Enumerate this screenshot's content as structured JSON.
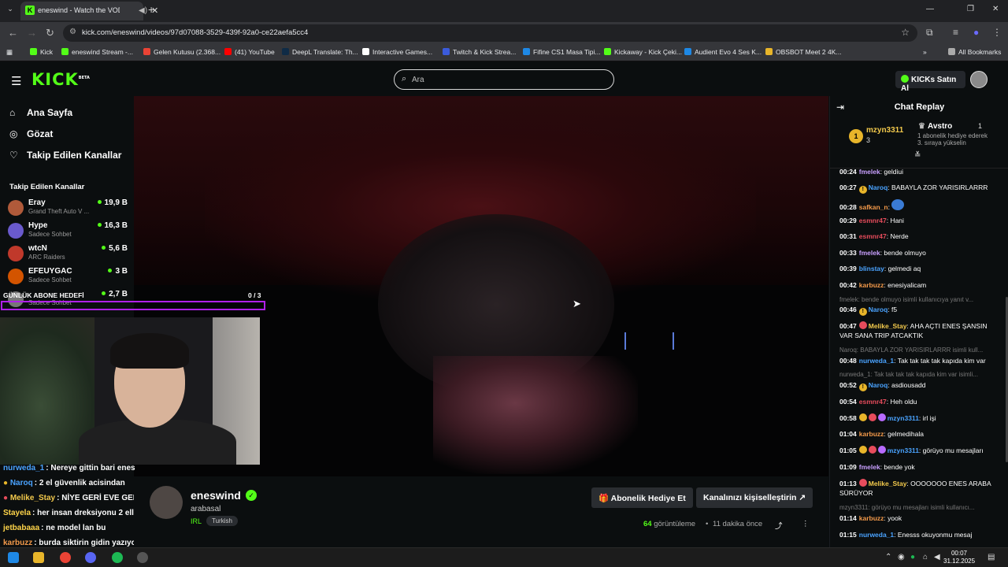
{
  "browser": {
    "tab_title": "eneswind - Watch the VOD",
    "url": "kick.com/eneswind/videos/97d07088-3529-439f-92a0-ce22aefa5cc4",
    "bookmarks": [
      "Kick",
      "eneswind Stream -...",
      "Gelen Kutusu (2.368...",
      "(41) YouTube",
      "DeepL Translate: Th...",
      "Interactive Games...",
      "Twitch & Kick Strea...",
      "Fifine CS1 Masa Tipi...",
      "Kickaway - Kick Çeki...",
      "Audient Evo 4 Ses K...",
      "OBSBOT Meet 2 4K..."
    ],
    "all_bookmarks": "All Bookmarks"
  },
  "header": {
    "logo": "KICK",
    "logo_badge": "BETA",
    "search_placeholder": "Ara",
    "kicks_button": "KICKs Satın Al"
  },
  "sidebar": {
    "nav": [
      {
        "label": "Ana Sayfa",
        "icon": "home-icon"
      },
      {
        "label": "Gözat",
        "icon": "browse-icon"
      },
      {
        "label": "Takip Edilen Kanallar",
        "icon": "heart-icon"
      }
    ],
    "following_title": "Takip Edilen Kanallar",
    "channels": [
      {
        "name": "Eray",
        "category": "Grand Theft Auto V ...",
        "viewers": "19,9 B",
        "color": "#b05a3a"
      },
      {
        "name": "Hype",
        "category": "Sadece Sohbet",
        "viewers": "16,3 B",
        "color": "#6a5acd"
      },
      {
        "name": "wtcN",
        "category": "ARC Raiders",
        "viewers": "5,6 B",
        "color": "#c0392b"
      },
      {
        "name": "EFEUYGAC",
        "category": "Sadece Sohbet",
        "viewers": "3 B",
        "color": "#d35400"
      },
      {
        "name": "",
        "category": "Sadece Sohbet",
        "viewers": "2,7 B",
        "color": "#777"
      }
    ]
  },
  "overlay": {
    "goal_label": "GÜNLÜK ABONE HEDEFİ",
    "goal_count": "0 / 3",
    "chat": [
      {
        "user": "nurweda_1",
        "text": ": Nereye gittin bari enes",
        "color": "#4aa3ff"
      },
      {
        "user": "Naroq",
        "text": ": 2 el güvenlik acisindan",
        "color": "#4aa3ff"
      },
      {
        "user": "Melike_Stay",
        "text": ": NİYE GERİ EVE GELDİN ENES",
        "color": "#f2c94c"
      },
      {
        "user": "Stayela",
        "text": ": her insan dreksiyonu 2 elle tutar",
        "color": "#ffd54a"
      },
      {
        "user": "jetbabaaa",
        "text": ": ne model lan bu",
        "color": "#ffd54a"
      },
      {
        "user": "karbuzz",
        "text": ": burda siktirin gidin yazıyodu ekranda",
        "color": "#f2994a"
      }
    ]
  },
  "video": {
    "channel": "eneswind",
    "title": "arabasal",
    "category": "IRL",
    "tag": "Turkish",
    "gift_button": "Abonelik Hediye Et",
    "customize_button": "Kanalınızı kişiselleştirin",
    "views_count": "64",
    "views_label": "görüntüleme",
    "time_ago": "11 dakika önce"
  },
  "chat": {
    "title": "Chat Replay",
    "pinned": {
      "top_user": "mzyn3311",
      "top_count": "3",
      "rank": "1",
      "second_user": "Avstro",
      "second_count": "1",
      "second_desc": "1 abonelik hediye ederek 3. sıraya yükselin"
    },
    "messages": [
      {
        "time": "00:24",
        "user": "fmelek",
        "text": ": geldiui",
        "color": "#c9a0ff"
      },
      {
        "time": "00:27",
        "user": "Naroq",
        "text": ": BABAYLA ZOR YARISIRLARRR",
        "color": "#4aa3ff",
        "badge": "#e8b52a"
      },
      {
        "time": "00:28",
        "user": "safkan_n",
        "text": ":",
        "color": "#f2994a"
      },
      {
        "time": "00:29",
        "user": "esmnr47",
        "text": ": Hani",
        "color": "#e74c5c"
      },
      {
        "time": "00:31",
        "user": "esmnr47",
        "text": ": Nerde",
        "color": "#e74c5c"
      },
      {
        "time": "00:33",
        "user": "fmelek",
        "text": ": bende olmuyo",
        "color": "#c9a0ff"
      },
      {
        "time": "00:39",
        "user": "blinstay",
        "text": ": gelmedi aq",
        "color": "#4aa3ff"
      },
      {
        "time": "00:42",
        "user": "karbuzz",
        "text": ": enesiyalicam",
        "color": "#f2994a"
      },
      {
        "time": "00:46",
        "user": "Naroq",
        "text": ": f5",
        "color": "#4aa3ff",
        "badge": "#e8b52a"
      },
      {
        "time": "00:47",
        "user": "Melike_Stay",
        "text": ": AHA AÇTI ENES ŞANSIN VAR SANA TRIP ATCAKTIK",
        "color": "#f2c94c"
      },
      {
        "time": "00:48",
        "user": "nurweda_1",
        "text": ": Tak tak tak tak kapıda kim var",
        "color": "#4aa3ff"
      },
      {
        "time": "00:52",
        "user": "Naroq",
        "text": ": asdiousadd",
        "color": "#4aa3ff",
        "badge": "#e8b52a"
      },
      {
        "time": "00:54",
        "user": "esmnr47",
        "text": ": Heh oldu",
        "color": "#e74c5c"
      },
      {
        "time": "00:58",
        "user": "mzyn3311",
        "text": ": irl işi",
        "color": "#4aa3ff"
      },
      {
        "time": "01:04",
        "user": "karbuzz",
        "text": ": gelmedihala",
        "color": "#f2994a"
      },
      {
        "time": "01:05",
        "user": "mzyn3311",
        "text": ": görüyo mu mesajları",
        "color": "#4aa3ff"
      },
      {
        "time": "01:09",
        "user": "fmelek",
        "text": ": bende yok",
        "color": "#c9a0ff"
      },
      {
        "time": "01:13",
        "user": "Melike_Stay",
        "text": ": OOOOOOO ENES ARABA SÜRÜYOR",
        "color": "#f2c94c"
      },
      {
        "time": "01:14",
        "user": "karbuzz",
        "text": ": yook",
        "color": "#f2994a"
      },
      {
        "time": "01:15",
        "user": "nurweda_1",
        "text": ": Enesss okuyonmu mesaj",
        "color": "#4aa3ff"
      }
    ],
    "replies": [
      "fmelek: bende olmuyo isimli kullanıcıya yanıt v...",
      "Naroq: BABAYLA ZOR YARISIRLARRR isimli kull...",
      "nurweda_1: Tak tak tak tak kapıda kim var isimli...",
      "mzyn3311: görüyo mu mesajları isimli kullanıcı..."
    ]
  },
  "taskbar": {
    "time": "00:07",
    "date": "31.12.2025"
  }
}
